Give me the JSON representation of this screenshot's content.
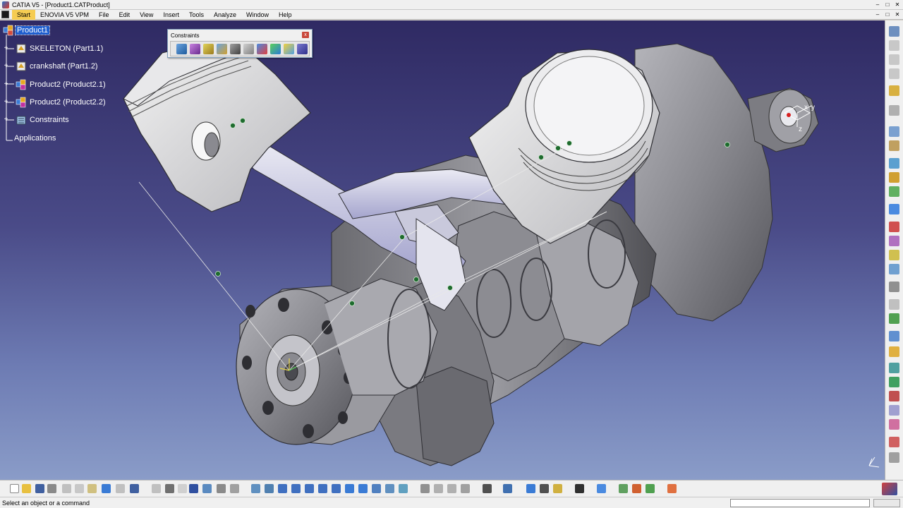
{
  "window": {
    "title": "CATIA V5 - [Product1.CATProduct]",
    "buttons": [
      "–",
      "□",
      "✕"
    ],
    "doc_buttons": [
      "–",
      "□",
      "✕"
    ]
  },
  "menu": {
    "items": [
      "Start",
      "ENOVIA V5 VPM",
      "File",
      "Edit",
      "View",
      "Insert",
      "Tools",
      "Analyze",
      "Window",
      "Help"
    ]
  },
  "tree": {
    "root": "Product1",
    "items": [
      {
        "label": "SKELETON (Part1.1)",
        "icon": "part-icon"
      },
      {
        "label": "crankshaft (Part1.2)",
        "icon": "part-icon"
      },
      {
        "label": "Product2 (Product2.1)",
        "icon": "product-icon"
      },
      {
        "label": "Product2 (Product2.2)",
        "icon": "product-icon"
      },
      {
        "label": "Constraints",
        "icon": "constraints-icon"
      }
    ],
    "applications": "Applications"
  },
  "constraints_toolbar": {
    "title": "Constraints",
    "close": "x",
    "icons": [
      "coincidence-constraint-icon",
      "contact-constraint-icon",
      "offset-constraint-icon",
      "angle-constraint-icon",
      "fix-component-icon",
      "fix-together-icon",
      "quick-constraint-icon",
      "flexible-rigid-icon",
      "change-constraint-icon",
      "reuse-pattern-icon"
    ]
  },
  "compass": {
    "labels": [
      "x",
      "y",
      "z"
    ]
  },
  "status": {
    "message": "Select an object or a command",
    "command_value": ""
  },
  "colors": {
    "selection": "#1f5fcf",
    "menu_start": "#f6cc52",
    "viewport_top": "#2f2a63",
    "viewport_bottom": "#8a9cc8",
    "metal": "#8e8e94",
    "piston": "#dcdcdc"
  }
}
